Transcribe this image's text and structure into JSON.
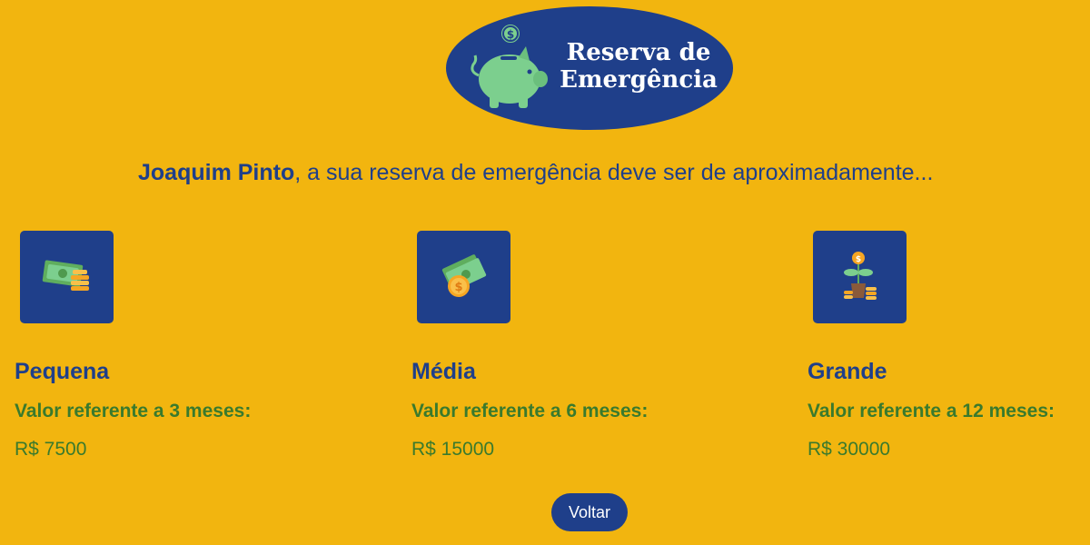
{
  "logo": {
    "line1": "Reserva de",
    "line2": "Emergência",
    "icon": "piggy-bank-icon",
    "colors": {
      "background": "#1f3f8a",
      "pig": "#7ccf8e"
    }
  },
  "headline": {
    "name": "Joaquim Pinto",
    "text": ", a sua reserva de emergência deve ser de aproximadamente..."
  },
  "cards": [
    {
      "icon": "cash-coins-icon",
      "title": "Pequena",
      "subtitle": "Valor referente a 3 meses:",
      "value": "R$ 7500"
    },
    {
      "icon": "money-coin-icon",
      "title": "Média",
      "subtitle": "Valor referente a 6 meses:",
      "value": "R$ 15000"
    },
    {
      "icon": "money-plant-icon",
      "title": "Grande",
      "subtitle": "Valor referente a 12 meses:",
      "value": "R$ 30000"
    }
  ],
  "back_button": {
    "label": "Voltar"
  },
  "colors": {
    "page_background": "#f2b50f",
    "primary": "#1f3f8a",
    "accent_green": "#3a7a2d"
  }
}
